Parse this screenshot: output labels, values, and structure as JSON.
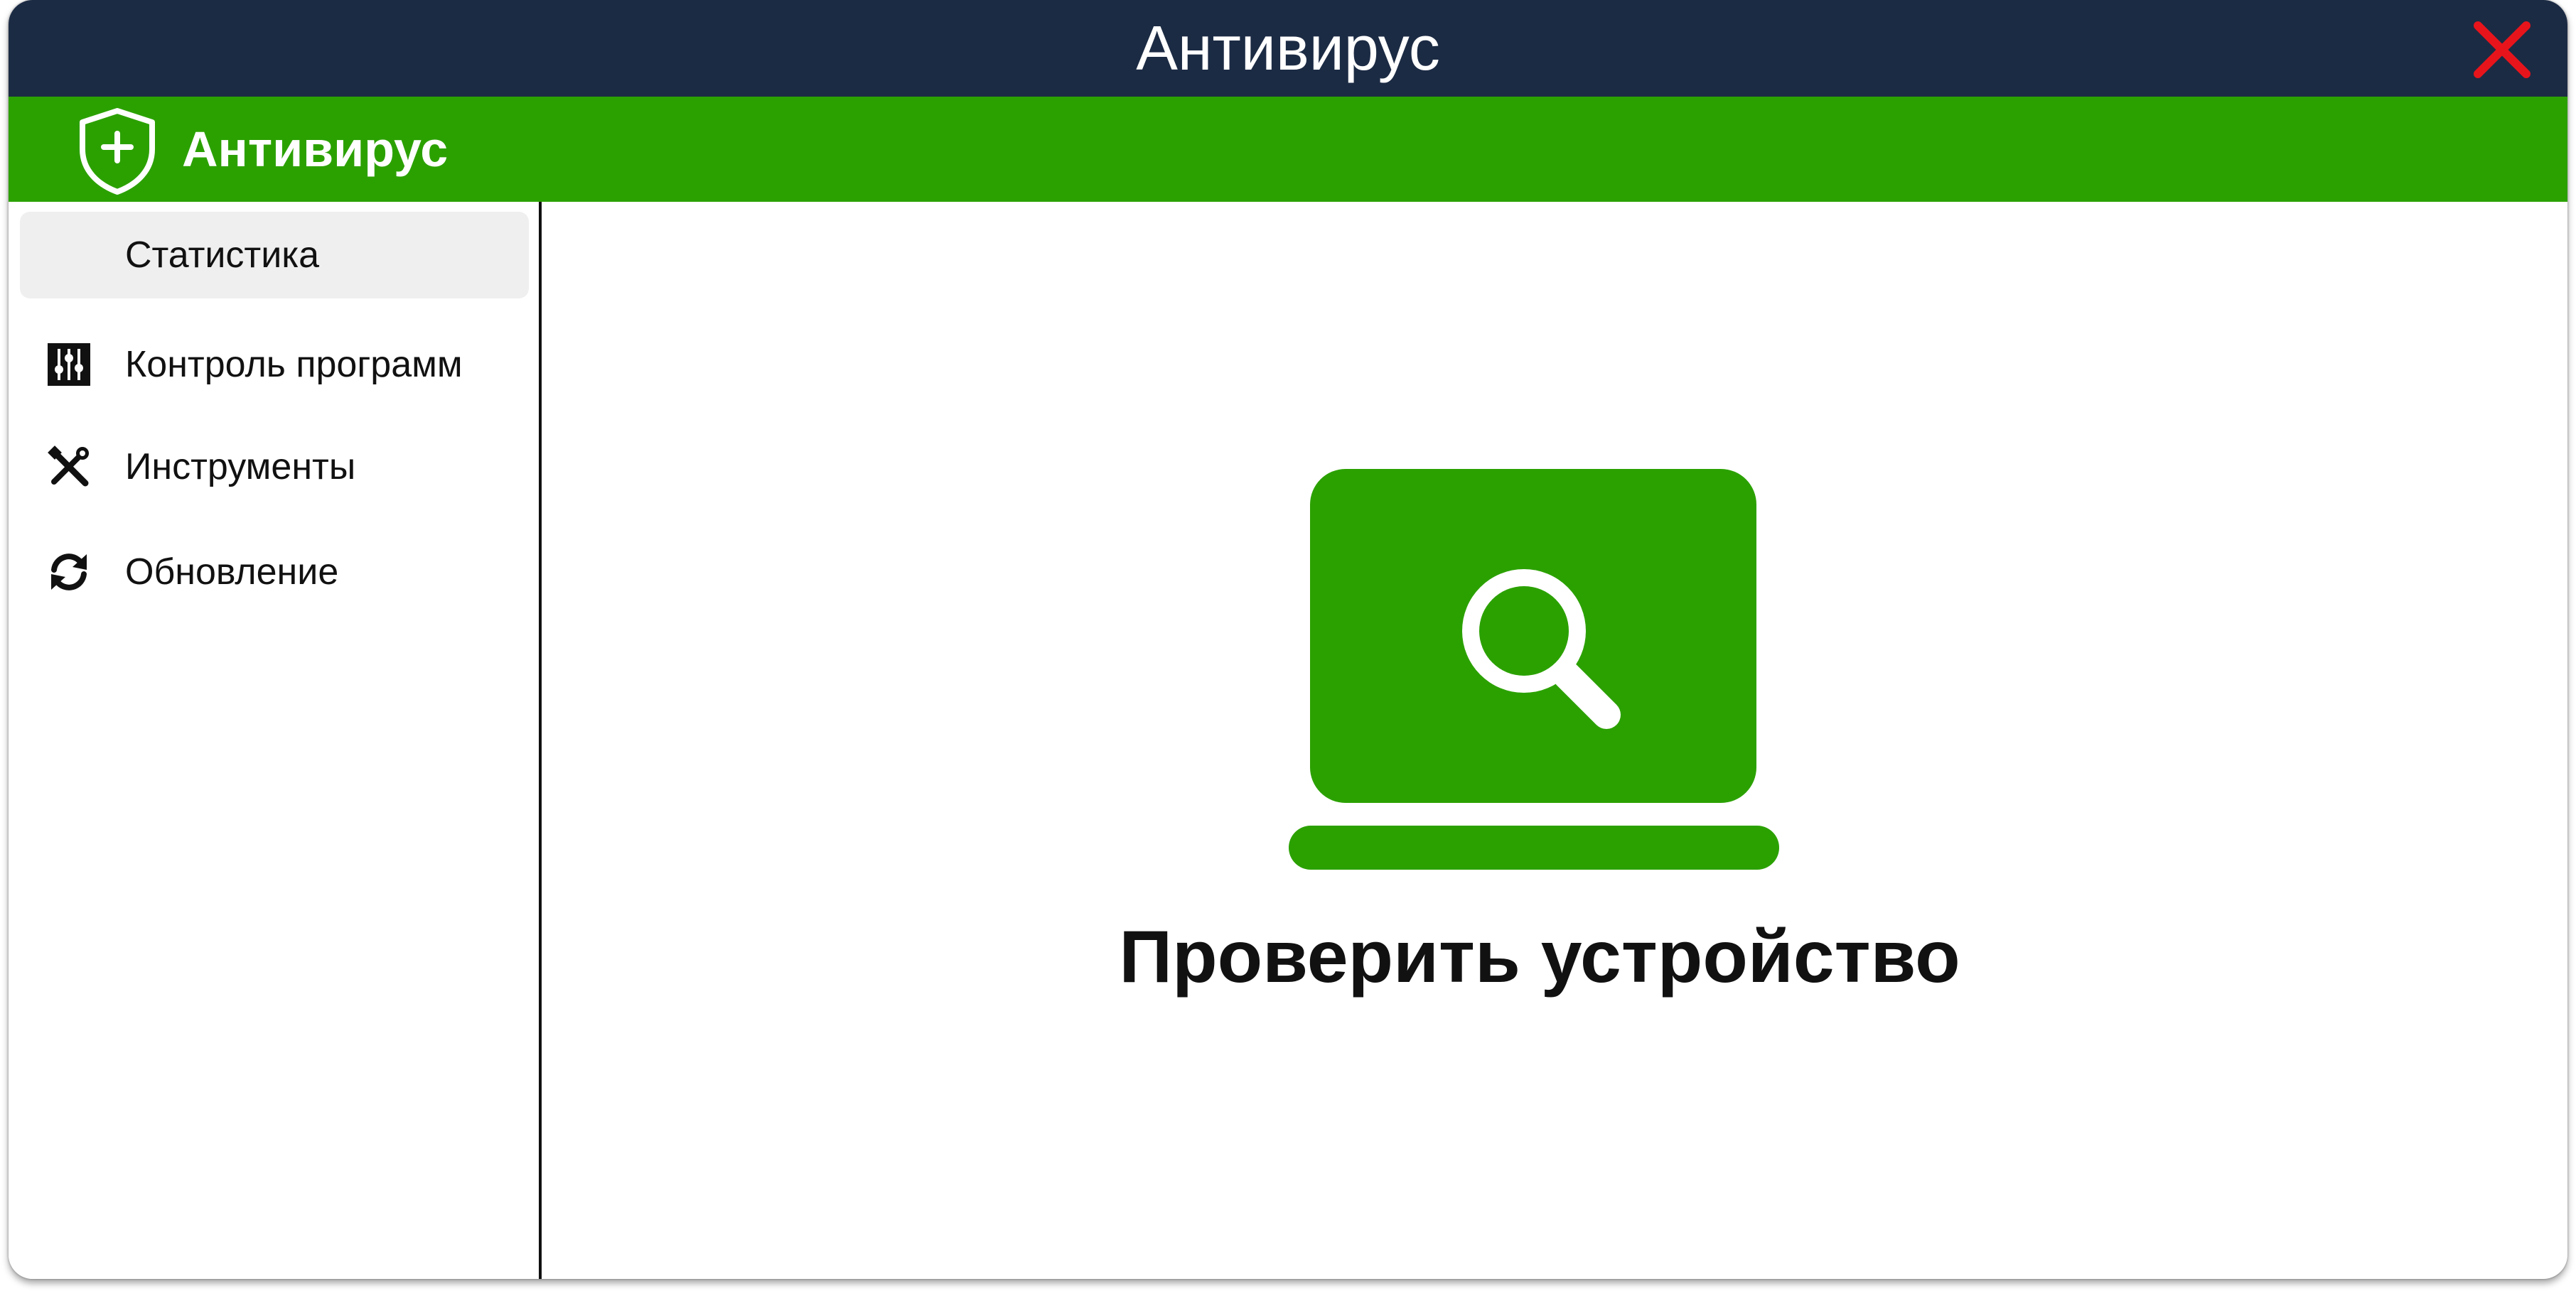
{
  "window": {
    "title": "Антивирус",
    "close_icon": "close-x-icon",
    "colors": {
      "titlebar": "#1c2b44",
      "close": "#e8141b"
    }
  },
  "app_header": {
    "name": "Антивирус",
    "logo_icon": "shield-plus-icon",
    "color": "#2ba100"
  },
  "sidebar": {
    "items": [
      {
        "label": "Статистика",
        "icon": "",
        "active": true
      },
      {
        "label": "Контроль программ",
        "icon": "sliders-icon",
        "active": false
      },
      {
        "label": "Инструменты",
        "icon": "tools-icon",
        "active": false
      },
      {
        "label": "Обновление",
        "icon": "refresh-icon",
        "active": false
      }
    ]
  },
  "main": {
    "scan_icon": "laptop-search-icon",
    "scan_label": "Проверить устройство",
    "accent": "#2ba100"
  }
}
